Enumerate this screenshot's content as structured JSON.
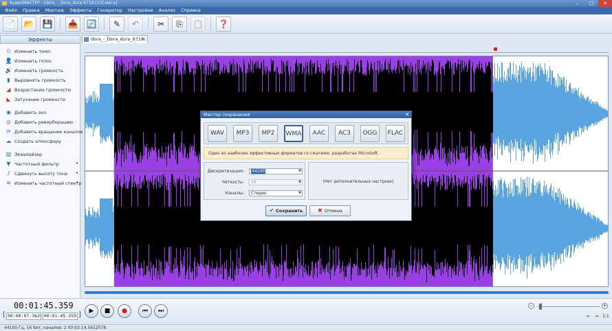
{
  "window": {
    "title": "АудиоМАСТЕР - [dora_-_Dora_dura 6718 [15]-мега]",
    "minimize": "–",
    "maximize": "□",
    "close": "✕"
  },
  "menu": [
    "Файл",
    "Правка",
    "Монтаж",
    "Эффекты",
    "Генератор",
    "Настройки",
    "Анализ",
    "Справка"
  ],
  "toolbar": {
    "icons": [
      {
        "name": "new-file-icon",
        "glyph": "📄"
      },
      {
        "name": "open-folder-icon",
        "glyph": "📂"
      },
      {
        "name": "save-icon",
        "glyph": "💾"
      },
      {
        "name": "export-icon",
        "glyph": "📥"
      },
      {
        "name": "refresh-icon",
        "glyph": "🔄"
      },
      {
        "name": "edit-icon",
        "glyph": "✎"
      },
      {
        "name": "undo-icon",
        "glyph": "↶"
      },
      {
        "name": "cut-icon",
        "glyph": "✂"
      },
      {
        "name": "copy-icon",
        "glyph": "⎘"
      },
      {
        "name": "paste-icon",
        "glyph": "📋"
      },
      {
        "name": "help-icon",
        "glyph": "❓"
      }
    ]
  },
  "effects_panel": {
    "title": "Эффекты",
    "items": [
      {
        "label": "Изменить темп",
        "icon": "⏲",
        "color": "#3a6ea8"
      },
      {
        "label": "Изменить голос",
        "icon": "👤",
        "color": "#8a5a2b"
      },
      {
        "label": "Изменить громкость",
        "icon": "🔊",
        "color": "#3a6ea8"
      },
      {
        "label": "Выровнять громкость",
        "icon": "▮",
        "color": "#2b8a4a"
      },
      {
        "label": "Возрастание громкости",
        "icon": "◢",
        "color": "#c2410c"
      },
      {
        "label": "Затухание громкости",
        "icon": "◣",
        "color": "#c2410c"
      },
      {
        "label": "Добавить эхо",
        "icon": "◉",
        "color": "#3a6ea8"
      },
      {
        "label": "Добавить реверберацию",
        "icon": "◎",
        "color": "#6b4ca8"
      },
      {
        "label": "Добавить вращение каналов",
        "icon": "⟳",
        "color": "#3a6ea8"
      },
      {
        "label": "Создать атмосферу",
        "icon": "☁",
        "color": "#3a6ea8"
      },
      {
        "label": "Эквалайзер",
        "icon": "▥",
        "color": "#2b8a4a"
      },
      {
        "label": "Частотный фильтр",
        "icon": "▼",
        "color": "#2b8a4a"
      },
      {
        "label": "Сдвинуть высоту тона",
        "icon": "♪",
        "color": "#3a6ea8"
      },
      {
        "label": "Изменить частотный спектр",
        "icon": "≋",
        "color": "#3a6ea8"
      }
    ]
  },
  "document_tab": {
    "label": "dora_-_Dora_dura_6718...",
    "close": "✕"
  },
  "waveform": {
    "selected_color": "#9b3fe6",
    "unselected_color": "#5aa4e2",
    "selection_start": 0.055,
    "selection_end": 0.78
  },
  "transport": {
    "current_time": "00:01:45.359",
    "selection_start": "00:00:07.362",
    "selection_end": "00:01:45.359",
    "separator": "–",
    "buttons": [
      {
        "name": "play-button",
        "glyph": "▶"
      },
      {
        "name": "stop-button",
        "glyph": "■"
      },
      {
        "name": "record-button",
        "glyph": "●"
      },
      {
        "name": "rewind-button",
        "glyph": "⏮"
      },
      {
        "name": "forward-button",
        "glyph": "⏭"
      }
    ]
  },
  "zoom": {
    "minus": "–",
    "plus": "+"
  },
  "small_buttons": [
    "↔",
    "↔",
    "1:1"
  ],
  "status": {
    "text": "44100 Гц, 16 бит, каналов: 2   00:02:14.5912578"
  },
  "dialog": {
    "title": "Мастер сохранения",
    "close": "✕",
    "formats": [
      "WAV",
      "MP3",
      "MP2",
      "WMA",
      "AAC",
      "AC3",
      "OGG",
      "FLAC"
    ],
    "selected_format": "WMA",
    "info": "Один из наиболее эффективных форматов со сжатием, разработан MicroSoft.",
    "fields": [
      {
        "label": "Дискретизация:",
        "value": "44100",
        "disabled": false,
        "highlight": true
      },
      {
        "label": "Чёткость:",
        "value": "16",
        "disabled": true,
        "highlight": false
      },
      {
        "label": "Каналы:",
        "value": "Стерео",
        "disabled": false,
        "highlight": false
      }
    ],
    "no_settings": "(Нет дополнительных настроек)",
    "save_label": "Сохранить",
    "cancel_label": "Отмена"
  }
}
